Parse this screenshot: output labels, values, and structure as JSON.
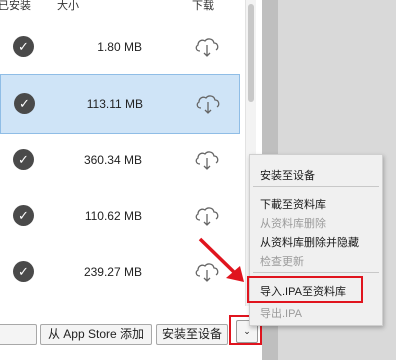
{
  "header": {
    "installed_label": "已安装",
    "size_label": "大小",
    "download_label": "下载"
  },
  "rows": [
    {
      "size": "1.80 MB",
      "selected": false
    },
    {
      "size": "113.11 MB",
      "selected": true
    },
    {
      "size": "360.34 MB",
      "selected": false
    },
    {
      "size": "110.62 MB",
      "selected": false
    },
    {
      "size": "239.27 MB",
      "selected": false
    }
  ],
  "toolbar": {
    "add_appstore_label": "从 App Store 添加",
    "install_label": "安装至设备",
    "more_label": "⌄"
  },
  "menu": {
    "items": [
      {
        "label": "安装至设备",
        "enabled": true
      },
      {
        "label": "下載至资料库",
        "enabled": true
      },
      {
        "label": "从资料库删除",
        "enabled": false
      },
      {
        "label": "从资料库删除并隐藏",
        "enabled": true
      },
      {
        "label": "检查更新",
        "enabled": false
      },
      {
        "label": "导入.IPA至资料库",
        "enabled": true
      },
      {
        "label": "导出.IPA",
        "enabled": false
      }
    ]
  },
  "colors": {
    "selection": "#cfe4f7",
    "highlight_red": "#e0141e",
    "check_bg": "#4a4a4a"
  },
  "icons": {
    "check": "check-circle-icon",
    "cloud": "cloud-download-icon"
  }
}
